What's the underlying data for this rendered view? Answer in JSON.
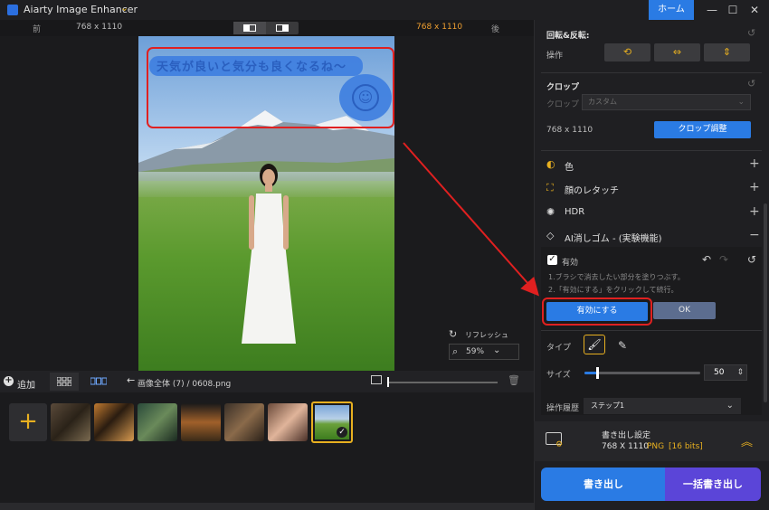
{
  "app": {
    "title": "Aiarty Image Enhancer",
    "home": "ホーム"
  },
  "compare": {
    "before_label": "前",
    "before_dim": "768 x 1110",
    "after_dim": "768 x 1110",
    "after_label": "後"
  },
  "canvas": {
    "brush_text": "天気が良いと気分も良くなるね～",
    "refresh": "リフレッシュ",
    "zoom": "59%"
  },
  "bottom": {
    "add": "追加",
    "breadcrumb": "画像全体 (7)  /  0608.png"
  },
  "panel": {
    "rotate_title": "回転&反転:",
    "rotate_op": "操作",
    "crop_title": "クロップ",
    "crop_label": "クロップ",
    "crop_value": "カスタム",
    "crop_dim": "768 x 1110",
    "crop_btn": "クロップ調整",
    "features": [
      "色",
      "顔のレタッチ",
      "HDR",
      "AI消しゴム - (実験機能)"
    ],
    "enabled": "有効",
    "step1": "1.ブラシで消去したい部分を塗りつぶす。",
    "step2": "2.「有効にする」をクリックして続行。",
    "enable_btn": "有効にする",
    "ok_btn": "OK",
    "type_label": "タイプ",
    "size_label": "サイズ",
    "size_value": "50",
    "history_label": "操作履歴",
    "history_value": "ステップ1"
  },
  "export": {
    "title": "書き出し設定",
    "dim": "768 X 1110",
    "format": "PNG",
    "bits": "[16 bits]",
    "export_btn": "書き出し",
    "batch_btn": "一括書き出し"
  },
  "colors": {
    "accent": "#2a7be4",
    "highlight": "#e02020",
    "gold": "#e8b020",
    "batch": "#5b45d8"
  }
}
